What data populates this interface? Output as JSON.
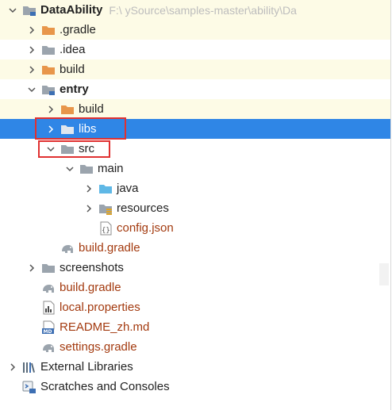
{
  "tree": {
    "root": {
      "label": "DataAbility",
      "path": "F:\\            ySource\\samples-master\\ability\\Da"
    },
    "items": [
      {
        "label": ".gradle"
      },
      {
        "label": ".idea"
      },
      {
        "label": "build"
      },
      {
        "label": "entry"
      },
      {
        "label": "build"
      },
      {
        "label": "libs"
      },
      {
        "label": "src"
      },
      {
        "label": "main"
      },
      {
        "label": "java"
      },
      {
        "label": "resources"
      },
      {
        "label": "config.json"
      },
      {
        "label": "build.gradle"
      },
      {
        "label": "screenshots"
      },
      {
        "label": "build.gradle"
      },
      {
        "label": "local.properties"
      },
      {
        "label": "README_zh.md"
      },
      {
        "label": "settings.gradle"
      },
      {
        "label": "External Libraries"
      },
      {
        "label": "Scratches and Consoles"
      }
    ]
  },
  "icons": {
    "folder": "folder-icon",
    "module": "module-folder-icon",
    "source": "source-folder-icon",
    "resources": "resources-folder-icon",
    "json": "json-file-icon",
    "gradle": "gradle-elephant-icon",
    "properties": "properties-file-icon",
    "markdown": "markdown-file-icon",
    "libraries": "libraries-icon",
    "scratches": "scratches-icon"
  },
  "colors": {
    "selection": "#2f86e6",
    "excluded_folder": "#e8964a",
    "folder": "#9ba4ad",
    "source_folder": "#5fb8e6",
    "gradle_text": "#a33a0f",
    "highlight_box": "#e03131",
    "row_tint": "#fdfbe6"
  }
}
